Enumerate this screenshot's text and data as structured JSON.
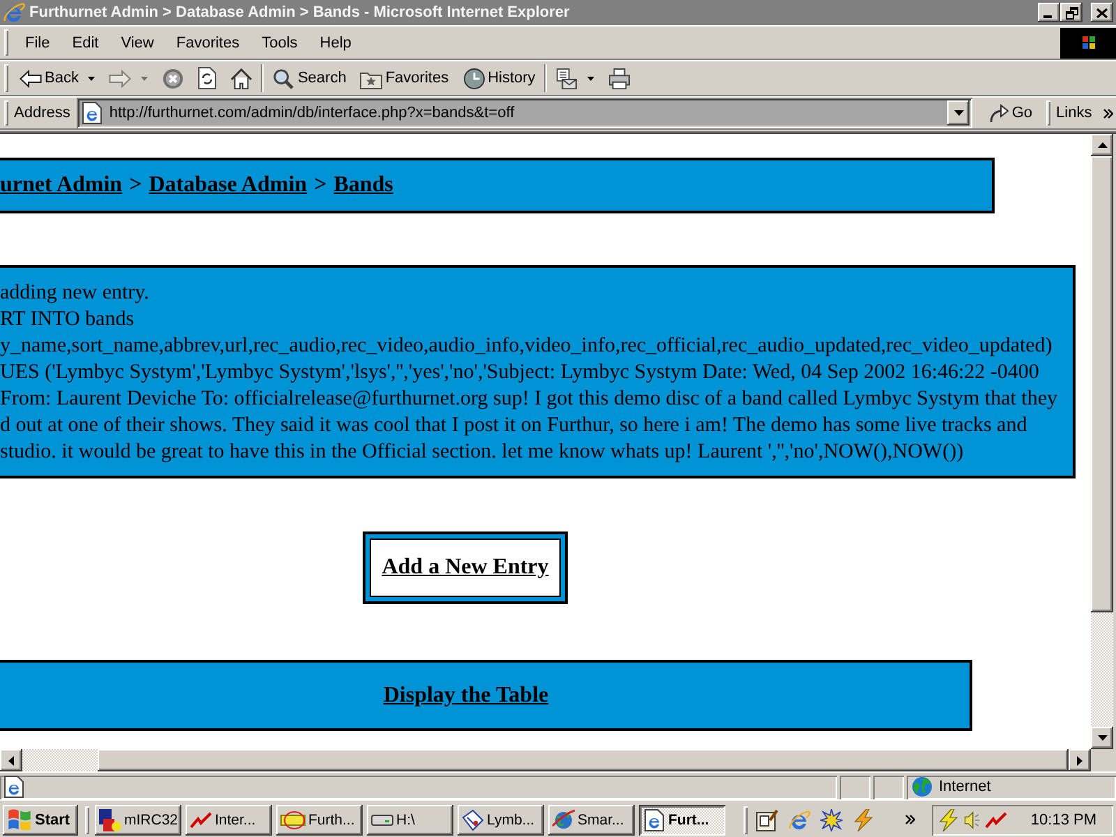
{
  "window": {
    "title": "Furthurnet Admin > Database Admin > Bands - Microsoft Internet Explorer"
  },
  "menu": [
    "File",
    "Edit",
    "View",
    "Favorites",
    "Tools",
    "Help"
  ],
  "toolbar": [
    {
      "buttons": [
        {
          "kind": "back",
          "label": "Back",
          "dropdown": true,
          "disabled": false
        },
        {
          "kind": "forward",
          "dropdown": true,
          "disabled": true
        },
        {
          "kind": "stop",
          "dropdown": false,
          "disabled": false
        },
        {
          "kind": "refresh",
          "dropdown": false,
          "disabled": false
        },
        {
          "kind": "home",
          "dropdown": false,
          "disabled": false
        }
      ]
    },
    {
      "buttons": [
        {
          "kind": "search",
          "label": "Search",
          "dropdown": false,
          "disabled": false
        },
        {
          "kind": "favorites",
          "label": "Favorites",
          "dropdown": false,
          "disabled": false
        },
        {
          "kind": "history",
          "label": "History",
          "dropdown": false,
          "disabled": false
        }
      ]
    },
    {
      "buttons": [
        {
          "kind": "mail",
          "dropdown": true,
          "disabled": false
        },
        {
          "kind": "print",
          "dropdown": false,
          "disabled": false
        }
      ]
    }
  ],
  "address": {
    "label": "Address",
    "url": "http://furthurnet.com/admin/db/interface.php?x=bands&t=off",
    "go": "Go",
    "links": "Links"
  },
  "page": {
    "breadcrumb": [
      {
        "kind": "link",
        "text": "urnet Admin"
      },
      {
        "kind": "separator",
        "text": ">"
      },
      {
        "kind": "link",
        "text": "Database Admin"
      },
      {
        "kind": "separator",
        "text": ">"
      },
      {
        "kind": "link",
        "text": "Bands"
      }
    ],
    "message": [
      "adding new entry.",
      "RT INTO bands",
      "y_name,sort_name,abbrev,url,rec_audio,rec_video,audio_info,video_info,rec_official,rec_audio_updated,rec_video_updated)",
      "UES ('Lymbyc Systym','Lymbyc Systym','lsys','','yes','no','Subject: Lymbyc Systym Date: Wed, 04 Sep 2002 16:46:22 -0400",
      "From: Laurent Deviche To: officialrelease@furthurnet.org sup! I got this demo disc of a band called Lymbyc Systym that they",
      "d out at one of their shows. They said it was cool that I post it on Furthur, so here i am! The demo has some live tracks and",
      "studio. it would be great to have this in the Official section. let me know whats up! Laurent ','','no',NOW(),NOW())"
    ],
    "add_button": "Add a New Entry",
    "table_link": "Display the Table"
  },
  "status_bar": {
    "zone": "Internet"
  },
  "taskbar": {
    "start": "Start",
    "tasks": [
      {
        "kind": "mirc",
        "label": "mIRC32",
        "selected": false
      },
      {
        "kind": "zigzag",
        "label": "Inter...",
        "selected": false
      },
      {
        "kind": "tag",
        "label": "Furth...",
        "selected": false
      },
      {
        "kind": "drive",
        "label": "H:\\",
        "selected": false
      },
      {
        "kind": "package",
        "label": "Lymb...",
        "selected": false
      },
      {
        "kind": "globe",
        "label": "Smar...",
        "selected": false
      },
      {
        "kind": "iepage",
        "label": "Furt...",
        "selected": true
      }
    ],
    "clock": "10:13 PM"
  }
}
